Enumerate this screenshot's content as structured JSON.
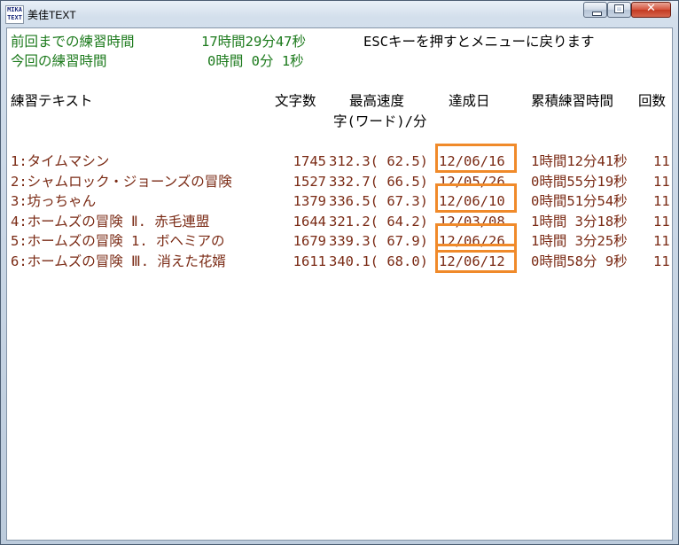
{
  "window": {
    "title": "美佳TEXT",
    "icon_text": [
      "MIKA",
      "TEXT"
    ]
  },
  "status": {
    "total_label": "前回までの練習時間",
    "total_value": "17時間29分47秒",
    "hint": "ESCキーを押すとメニューに戻ります",
    "session_label": "今回の練習時間",
    "session_value": "0時間 0分 1秒"
  },
  "headers": {
    "text": "練習テキスト",
    "chars": "文字数",
    "speed": "最高速度",
    "speed_unit": "字(ワード)/分",
    "date": "達成日",
    "time": "累積練習時間",
    "count": "回数"
  },
  "rows": [
    {
      "name": "1:タイムマシン",
      "chars": "1745",
      "speed": "312.3( 62.5)",
      "date": "12/06/16",
      "time": "1時間12分41秒",
      "count": "11",
      "highlighted": true
    },
    {
      "name": "2:シャムロック・ジョーンズの冒険",
      "chars": "1527",
      "speed": "332.7( 66.5)",
      "date": "12/05/26",
      "time": "0時間55分19秒",
      "count": "11",
      "highlighted": false
    },
    {
      "name": "3:坊っちゃん",
      "chars": "1379",
      "speed": "336.5( 67.3)",
      "date": "12/06/10",
      "time": "0時間51分54秒",
      "count": "11",
      "highlighted": true
    },
    {
      "name": "4:ホームズの冒険 Ⅱ. 赤毛連盟",
      "chars": "1644",
      "speed": "321.2( 64.2)",
      "date": "12/03/08",
      "time": "1時間 3分18秒",
      "count": "11",
      "highlighted": false
    },
    {
      "name": "5:ホームズの冒険 1. ボヘミアの",
      "chars": "1679",
      "speed": "339.3( 67.9)",
      "date": "12/06/26",
      "time": "1時間 3分25秒",
      "count": "11",
      "highlighted": true
    },
    {
      "name": "6:ホームズの冒険 Ⅲ. 消えた花婿",
      "chars": "1611",
      "speed": "340.1( 68.0)",
      "date": "12/06/12",
      "time": "0時間58分 9秒",
      "count": "11",
      "highlighted": true
    }
  ],
  "colors": {
    "status_text": "#1c7a1c",
    "row_text": "#7a2a14",
    "header_text": "#000000",
    "highlight_box": "#f08a2a"
  }
}
